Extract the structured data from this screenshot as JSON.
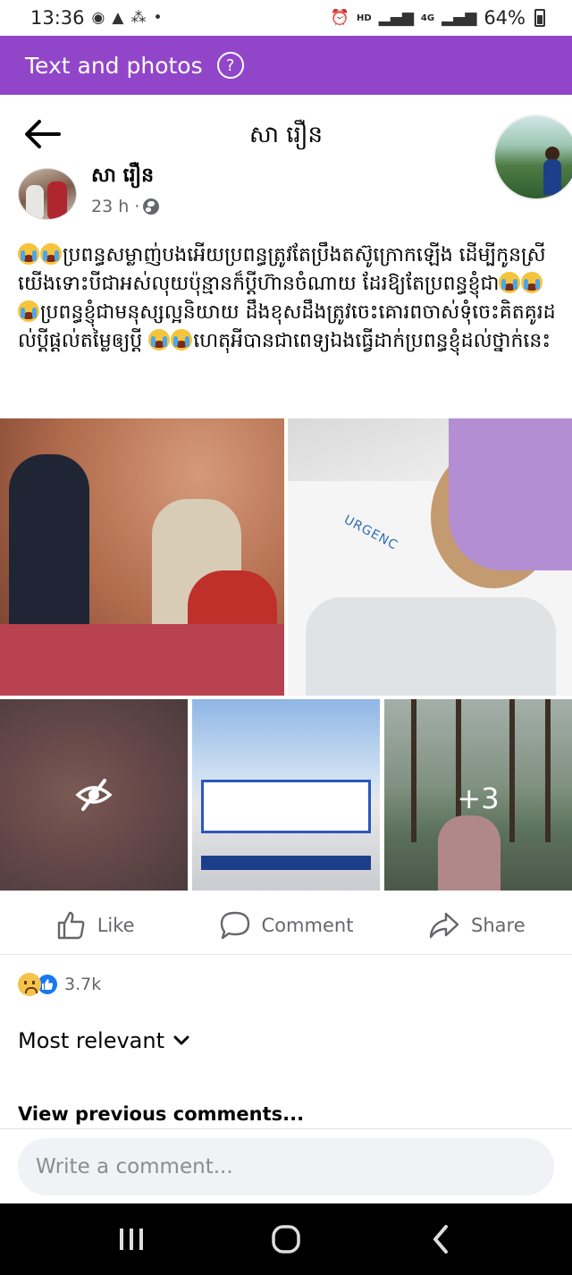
{
  "status_bar": {
    "time": "13:36",
    "network_label": "HD",
    "network_gen": "4G",
    "battery": "64%"
  },
  "banner": {
    "title": "Text and photos",
    "help_icon": "help-circle-icon",
    "bg_color": "#9146c9"
  },
  "header": {
    "title": "សា រឿន",
    "back_icon": "arrow-left-icon"
  },
  "post": {
    "author": "សា រឿន",
    "time": "23 h ·",
    "privacy_icon": "globe-icon",
    "text_segments": [
      {
        "emoji": 2,
        "text": "ប្រពន្ធសម្លាញ់បងអើយប្រពន្ធត្រូវតែប្រឹងតស៊ូក្រោកឡើង ដើម្បីកូនស្រីយើងទោះបីជាអស់លុយប៉ុន្មានក៏ប្ដីហ៊ានចំណាយ ដែរឱ្យតែប្រពន្ធខ្ញុំជា"
      },
      {
        "emoji": 3,
        "text": "ប្រពន្ធខ្ញុំជាមនុស្សល្អនិយាយ ដឹងខុសដឹងត្រូវចេះគោរពចាស់ទុំចេះគិតគូរដល់ប្ដីផ្ដល់តម្លៃឲ្យប្ដី"
      },
      {
        "emoji": 2,
        "text": "ហេតុអីបានជាពេទ្យឯងធ្វើដាក់ប្រពន្ធខ្ញុំដល់ថ្នាក់នេះ"
      }
    ],
    "photo_label": "URGENC",
    "more_photos": "+3",
    "hidden_icon": "eye-slash-icon"
  },
  "actions": {
    "like": "Like",
    "comment": "Comment",
    "share": "Share"
  },
  "reactions": {
    "count": "3.7k",
    "types": [
      "sad",
      "like"
    ],
    "like_color": "#1877f2"
  },
  "comments": {
    "sort_label": "Most relevant",
    "view_previous": "View previous comments...",
    "input_placeholder": "Write a comment..."
  },
  "nav": {
    "recent_icon": "recent-apps-icon",
    "home_icon": "home-icon",
    "back_icon": "back-chevron-icon"
  }
}
